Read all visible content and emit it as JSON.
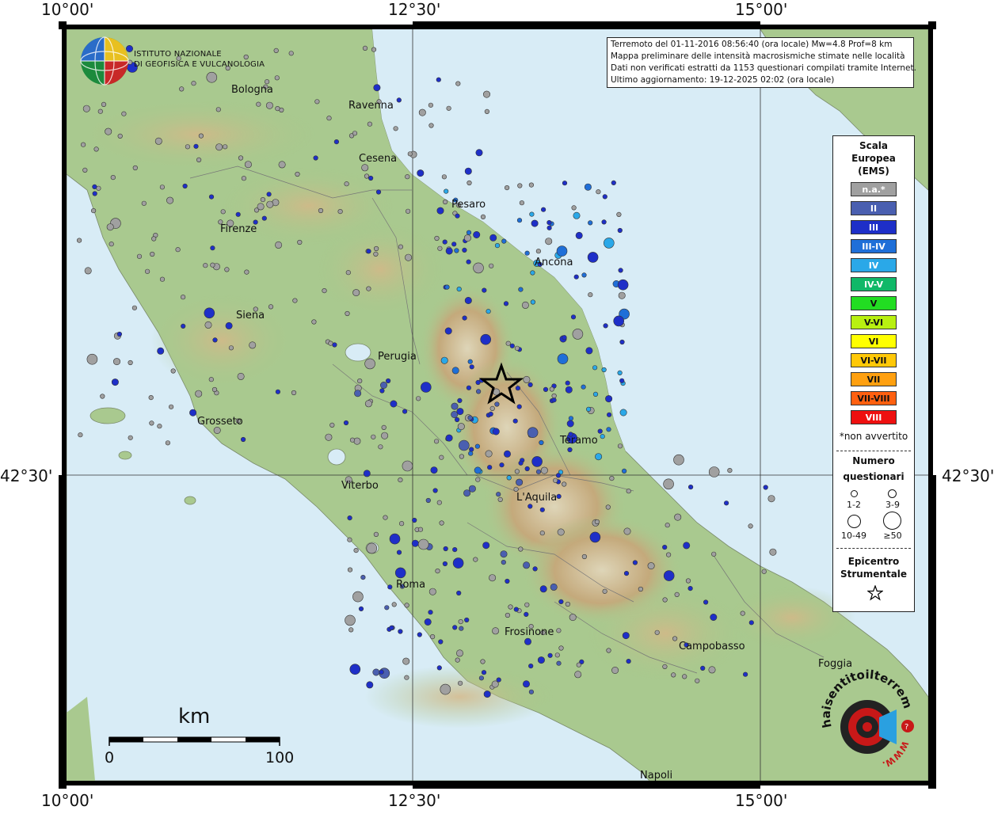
{
  "coordinates": {
    "top": [
      "10°00'",
      "12°30'",
      "15°00'"
    ],
    "bottom": [
      "10°00'",
      "12°30'",
      "15°00'"
    ],
    "left": "42°30'",
    "right": "42°30'"
  },
  "institute": {
    "line1": "ISTITUTO NAZIONALE",
    "line2": "DI GEOFISICA E VULCANOLOGIA"
  },
  "info": {
    "line1": "Terremoto del 01-11-2016 08:56:40 (ora locale) Mw=4.8 Prof=8 km",
    "line2": "Mappa preliminare delle intensità macrosismiche stimate nelle località",
    "line3": "Dati non verificati estratti da 1153 questionari compilati tramite Internet.",
    "line4": "Ultimo aggiornamento: 19-12-2025 02:02 (ora locale)"
  },
  "legend": {
    "title": [
      "Scala",
      "Europea",
      "(EMS)"
    ],
    "ems": [
      {
        "label": "n.a.*",
        "color": "#a0a0a0"
      },
      {
        "label": "II",
        "color": "#4a5fb0"
      },
      {
        "label": "III",
        "color": "#1e2fc8"
      },
      {
        "label": "III-IV",
        "color": "#1f6fd8"
      },
      {
        "label": "IV",
        "color": "#2aa8e8"
      },
      {
        "label": "IV-V",
        "color": "#10b868"
      },
      {
        "label": "V",
        "color": "#22dd22"
      },
      {
        "label": "V-VI",
        "color": "#b8f010"
      },
      {
        "label": "VI",
        "color": "#ffff00"
      },
      {
        "label": "VI-VII",
        "color": "#ffc808"
      },
      {
        "label": "VII",
        "color": "#ffa010"
      },
      {
        "label": "VII-VIII",
        "color": "#ff6010"
      },
      {
        "label": "VIII",
        "color": "#ee1010"
      }
    ],
    "na_note": "*non avvertito",
    "questionnaires_title": [
      "Numero",
      "questionari"
    ],
    "sizes": [
      "1-2",
      "3-9",
      "10-49",
      "≥50"
    ],
    "epicenter_title": [
      "Epicentro",
      "Strumentale"
    ]
  },
  "cities": [
    "Bologna",
    "Ravenna",
    "Cesena",
    "Pesaro",
    "Firenze",
    "Ancona",
    "Siena",
    "Perugia",
    "Grosseto",
    "Teramo",
    "Viterbo",
    "L'Aquila",
    "Roma",
    "Frosinone",
    "Campobasso",
    "Foggia",
    "Napoli"
  ],
  "scale_bar": {
    "unit": "km",
    "start": "0",
    "end": "100"
  },
  "brand": {
    "text": "haisentitoilterremoto.it",
    "url_text": "WWW.",
    "accent": "#cc1111"
  },
  "colors": {
    "sea": "#d8ecf6",
    "land": "#a8c890",
    "mountain": "#c8a070"
  }
}
